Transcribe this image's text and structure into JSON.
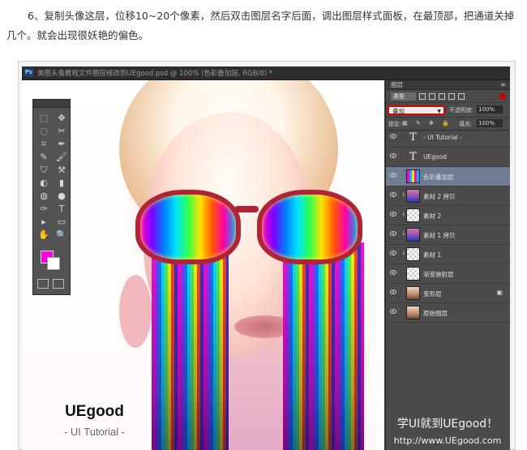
{
  "article": {
    "paragraph": "6、复制头像这层，位移10~20个像素，然后双击图层名字后面，调出图层样式面板，在最顶部，把通道关掉几个。就会出现很妖艳的偏色。"
  },
  "window": {
    "logo": "Ps",
    "doc_tab": "美图头像教程文件图层修改到UEgood.psd @ 100% (色彩叠加层, RGB/8) *"
  },
  "canvas": {
    "brand_name": "UEgood",
    "brand_sub": "- UI Tutorial -"
  },
  "toolbox": {
    "tools": [
      "⬚",
      "✥",
      "◌",
      "✂",
      "⌗",
      "✒",
      "✎",
      "🖌",
      "⛉",
      "⚒",
      "◐",
      "▮",
      "◍",
      "●",
      "✑",
      "T",
      "▸",
      "▭",
      "✋",
      "🔍"
    ],
    "foreground_color": "#ff00e6",
    "background_color": "#ffffff"
  },
  "layers_panel": {
    "tab_label": "图层",
    "menu_icon": "≡",
    "filter_label": "类型",
    "blend_mode": "叠加",
    "opacity_label": "不透明度:",
    "opacity_value": "100%",
    "lock_label": "锁定:",
    "lock_icons": "▦ ✎ ✥ 🔒",
    "fill_label": "填充:",
    "fill_value": "100%",
    "layers": [
      {
        "name": "- UI Tutorial -",
        "thumb": "T"
      },
      {
        "name": "UEgood",
        "thumb": "T"
      },
      {
        "name": "色彩叠加层",
        "thumb": ""
      },
      {
        "name": "素材 2 拷贝",
        "thumb": ""
      },
      {
        "name": "素材 2",
        "thumb": ""
      },
      {
        "name": "素材 1 拷贝",
        "thumb": ""
      },
      {
        "name": "素材 1",
        "thumb": ""
      },
      {
        "name": "渐变映射层",
        "thumb": ""
      },
      {
        "name": "变形层",
        "thumb": ""
      },
      {
        "name": "原始图层",
        "thumb": ""
      }
    ],
    "selected_layer": "色彩叠加层"
  },
  "watermark": {
    "title": "学UI就到UEgood！",
    "url": "http://www.UEgood.com"
  }
}
